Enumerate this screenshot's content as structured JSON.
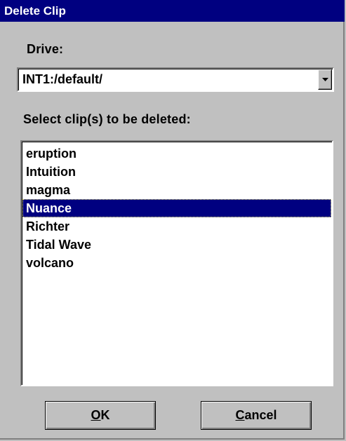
{
  "window": {
    "title": "Delete Clip"
  },
  "drive": {
    "label": "Drive:",
    "selected_value": "INT1:/default/"
  },
  "clips": {
    "label": "Select clip(s) to be deleted:",
    "items": [
      {
        "label": "eruption",
        "selected": false
      },
      {
        "label": "Intuition",
        "selected": false
      },
      {
        "label": "magma",
        "selected": false
      },
      {
        "label": "Nuance",
        "selected": true
      },
      {
        "label": "Richter",
        "selected": false
      },
      {
        "label": "Tidal Wave",
        "selected": false
      },
      {
        "label": "volcano",
        "selected": false
      }
    ]
  },
  "buttons": {
    "ok": {
      "mnemonic": "O",
      "rest": "K"
    },
    "cancel": {
      "mnemonic": "C",
      "rest": "ancel"
    }
  },
  "icons": {
    "dropdown": "dropdown-arrow-icon"
  },
  "colors": {
    "titlebar": "#000080",
    "selection": "#000080",
    "face": "#c0c0c0"
  }
}
